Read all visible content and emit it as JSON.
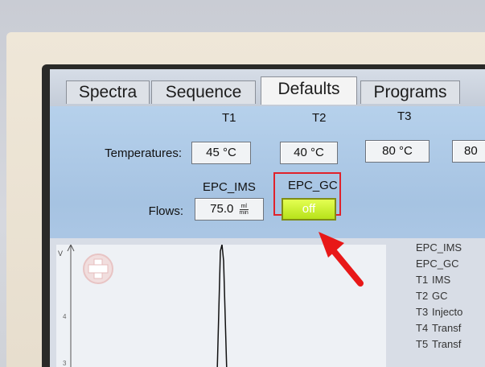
{
  "tabs": [
    {
      "label": "Spectra"
    },
    {
      "label": "Sequence"
    },
    {
      "label": "Defaults",
      "active": true
    },
    {
      "label": "Programs"
    }
  ],
  "temperatures": {
    "label": "Temperatures:",
    "columns": [
      "T1",
      "T2",
      "T3"
    ],
    "values": [
      "45 °C",
      "40 °C",
      "80 °C",
      "80"
    ]
  },
  "flows": {
    "label": "Flows:",
    "columns": [
      "EPC_IMS",
      "EPC_GC"
    ],
    "epc_ims_value": "75.0",
    "unit_num": "ml",
    "unit_den": "min",
    "epc_gc_value": "off"
  },
  "plot": {
    "y_axis_top": "V",
    "ticks": [
      "4",
      "3"
    ]
  },
  "legend": [
    {
      "id": "",
      "name": "EPC_IMS"
    },
    {
      "id": "",
      "name": "EPC_GC"
    },
    {
      "id": "T1",
      "name": "IMS"
    },
    {
      "id": "T2",
      "name": "GC"
    },
    {
      "id": "T3",
      "name": "Injecto"
    },
    {
      "id": "T4",
      "name": "Transf"
    },
    {
      "id": "T5",
      "name": "Transf"
    }
  ],
  "colors": {
    "highlight_box": "#e0222b",
    "arrow": "#e81818",
    "off_button": "#c7ef2b"
  }
}
